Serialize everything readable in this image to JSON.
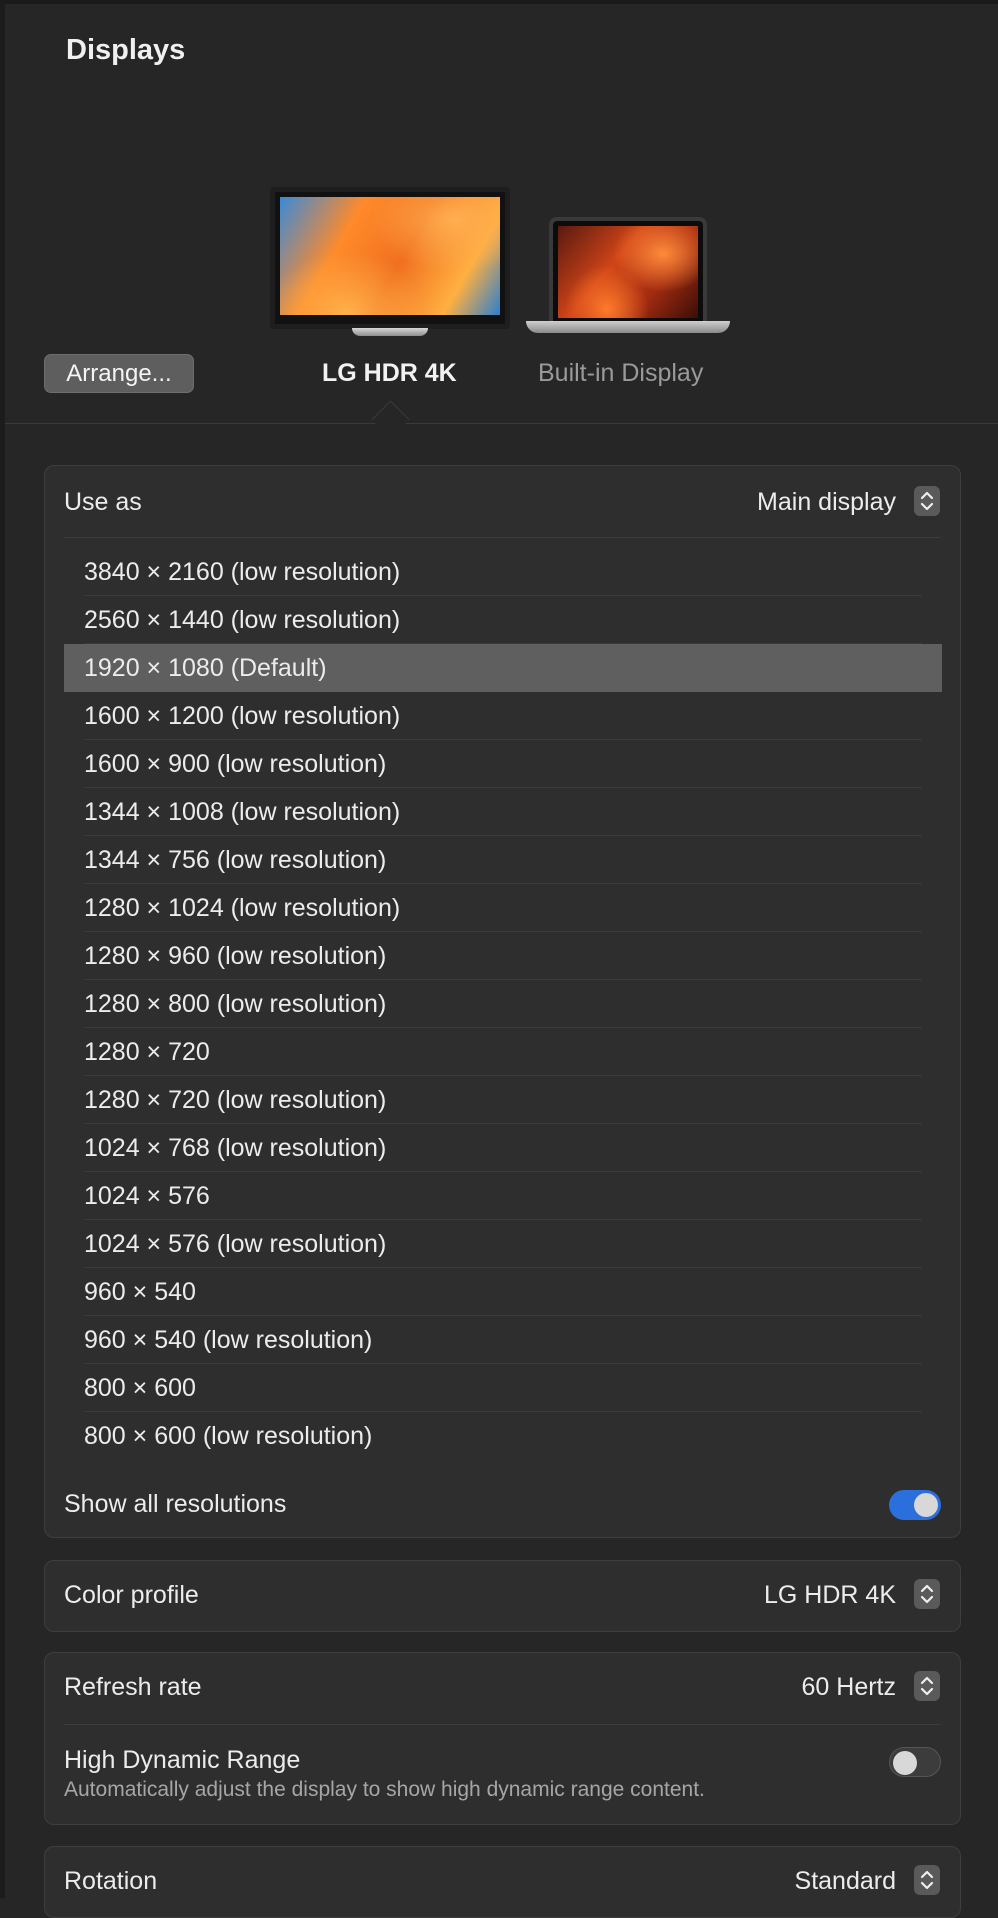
{
  "window": {
    "title": "Displays"
  },
  "displays": {
    "arrange_label": "Arrange...",
    "items": [
      {
        "label": "LG HDR 4K",
        "selected": true
      },
      {
        "label": "Built-in Display",
        "selected": false
      }
    ]
  },
  "use_as": {
    "label": "Use as",
    "value": "Main display"
  },
  "resolutions": {
    "selected_index": 2,
    "items": [
      "3840 × 2160 (low resolution)",
      "2560 × 1440 (low resolution)",
      "1920 × 1080 (Default)",
      "1600 × 1200 (low resolution)",
      "1600 × 900 (low resolution)",
      "1344 × 1008 (low resolution)",
      "1344 × 756 (low resolution)",
      "1280 × 1024 (low resolution)",
      "1280 × 960 (low resolution)",
      "1280 × 800 (low resolution)",
      "1280 × 720",
      "1280 × 720 (low resolution)",
      "1024 × 768 (low resolution)",
      "1024 × 576",
      "1024 × 576 (low resolution)",
      "960 × 540",
      "960 × 540 (low resolution)",
      "800 × 600",
      "800 × 600 (low resolution)"
    ]
  },
  "show_all_resolutions": {
    "label": "Show all resolutions",
    "on": true
  },
  "color_profile": {
    "label": "Color profile",
    "value": "LG HDR 4K"
  },
  "refresh_rate": {
    "label": "Refresh rate",
    "value": "60 Hertz"
  },
  "hdr": {
    "label": "High Dynamic Range",
    "description": "Automatically adjust the display to show high dynamic range content.",
    "on": false
  },
  "rotation": {
    "label": "Rotation",
    "value": "Standard"
  },
  "colors": {
    "accent": "#2a6fdb",
    "selected_row": "#5f5f5f",
    "background": "#262626"
  }
}
